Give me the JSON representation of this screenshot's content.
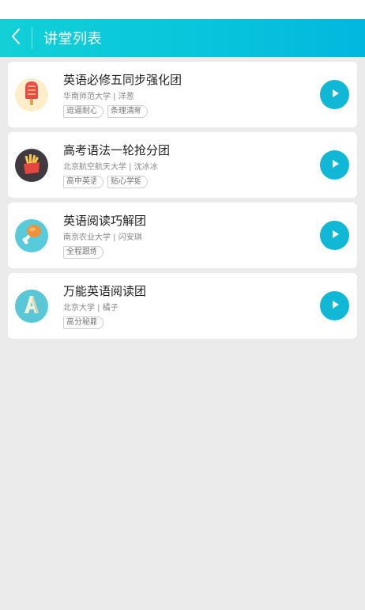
{
  "header": {
    "title": "讲堂列表",
    "back_icon": "chevron-left-icon"
  },
  "colors": {
    "header_gradient_start": "#12d0d6",
    "header_gradient_end": "#02b7de",
    "play_button": "#10b8d6",
    "page_background": "#ebebeb"
  },
  "courses": [
    {
      "title": "英语必修五同步强化团",
      "school": "华南师范大学",
      "teacher": "洋葱",
      "meta": "华南师范大学 | 洋葱",
      "tags": [
        "逗逼耐心",
        "条理清晰"
      ],
      "avatar_icon": "popsicle-icon",
      "avatar_bg": "#fbeec8"
    },
    {
      "title": "高考语法一轮抢分团",
      "school": "北京航空航天大学",
      "teacher": "沈冰冰",
      "meta": "北京航空航天大学 | 沈冰冰",
      "tags": [
        "高中英语",
        "贴心学姐"
      ],
      "avatar_icon": "fries-icon",
      "avatar_bg": "#40393f"
    },
    {
      "title": "英语阅读巧解团",
      "school": "南京农业大学",
      "teacher": "闪安琪",
      "meta": "南京农业大学 | 闪安琪",
      "tags": [
        "全程跟练"
      ],
      "avatar_icon": "drumstick-icon",
      "avatar_bg": "#57cbd9"
    },
    {
      "title": "万能英语阅读团",
      "school": "北京大学",
      "teacher": "橘子",
      "meta": "北京大学 | 橘子",
      "tags": [
        "高分秘籍"
      ],
      "avatar_icon": "letter-a-icon",
      "avatar_bg": "#5ac7d6"
    }
  ]
}
